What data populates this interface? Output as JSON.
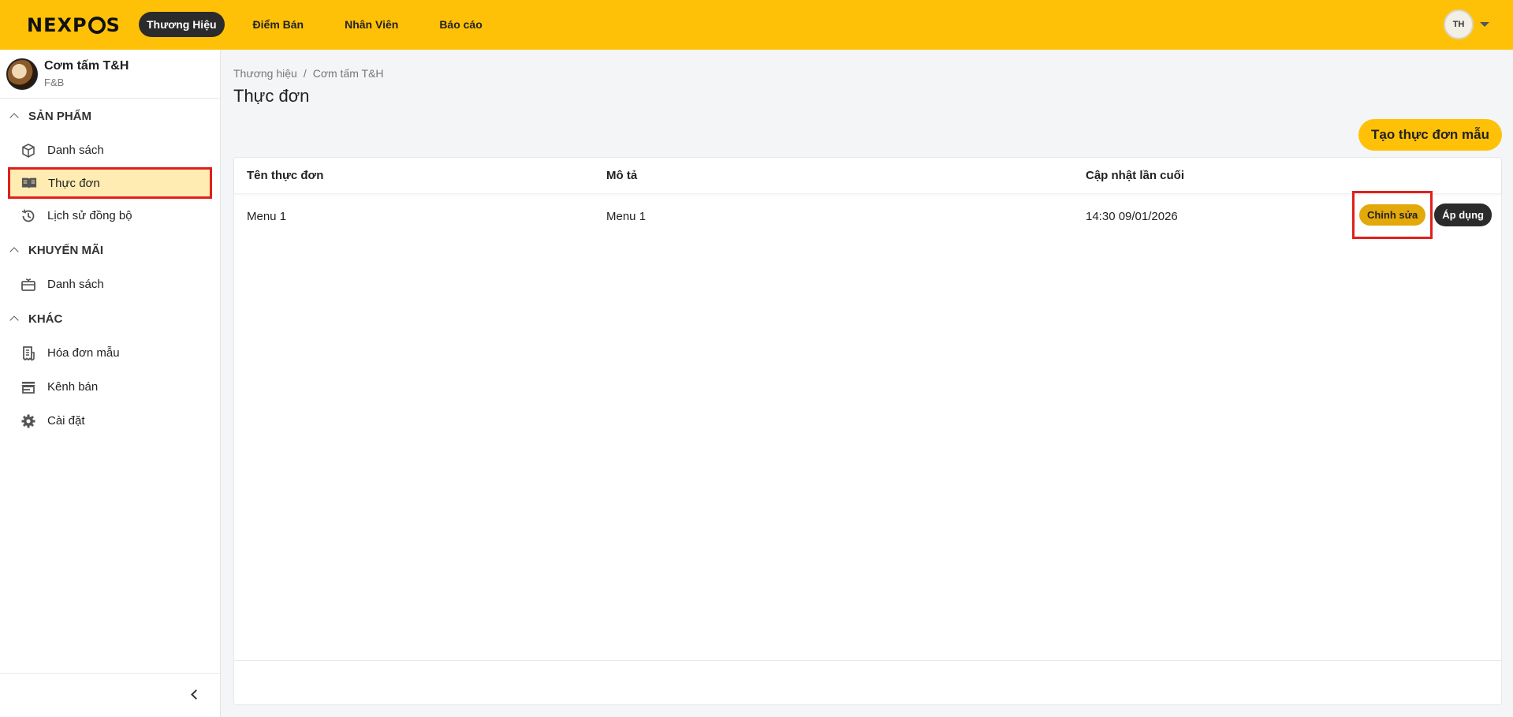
{
  "header": {
    "logo_text_1": "NEXP",
    "logo_text_2": "S",
    "nav": [
      "Thương Hiệu",
      "Điểm Bán",
      "Nhân Viên",
      "Báo cáo"
    ],
    "avatar_initials": "TH"
  },
  "sidebar": {
    "brand_name": "Cơm tấm T&H",
    "brand_type": "F&B",
    "sections": [
      {
        "title": "SẢN PHẨM",
        "items": [
          "Danh sách",
          "Thực đơn",
          "Lịch sử đồng bộ"
        ]
      },
      {
        "title": "KHUYẾN MÃI",
        "items": [
          "Danh sách"
        ]
      },
      {
        "title": "KHÁC",
        "items": [
          "Hóa đơn mẫu",
          "Kênh bán",
          "Cài đặt"
        ]
      }
    ]
  },
  "main": {
    "breadcrumb": [
      "Thương hiệu",
      "Cơm tấm T&H"
    ],
    "breadcrumb_sep": "/",
    "title": "Thực đơn",
    "create_button": "Tạo thực đơn mẫu",
    "table": {
      "headers": [
        "Tên thực đơn",
        "Mô tả",
        "Cập nhật lần cuối"
      ],
      "rows": [
        {
          "name": "Menu 1",
          "description": "Menu 1",
          "updated": "14:30 09/01/2026"
        }
      ],
      "edit_label": "Chỉnh sửa",
      "apply_label": "Áp dụng"
    }
  },
  "colors": {
    "accent": "#ffc107",
    "highlight": "#e0201b",
    "dark": "#2b2b2b"
  }
}
